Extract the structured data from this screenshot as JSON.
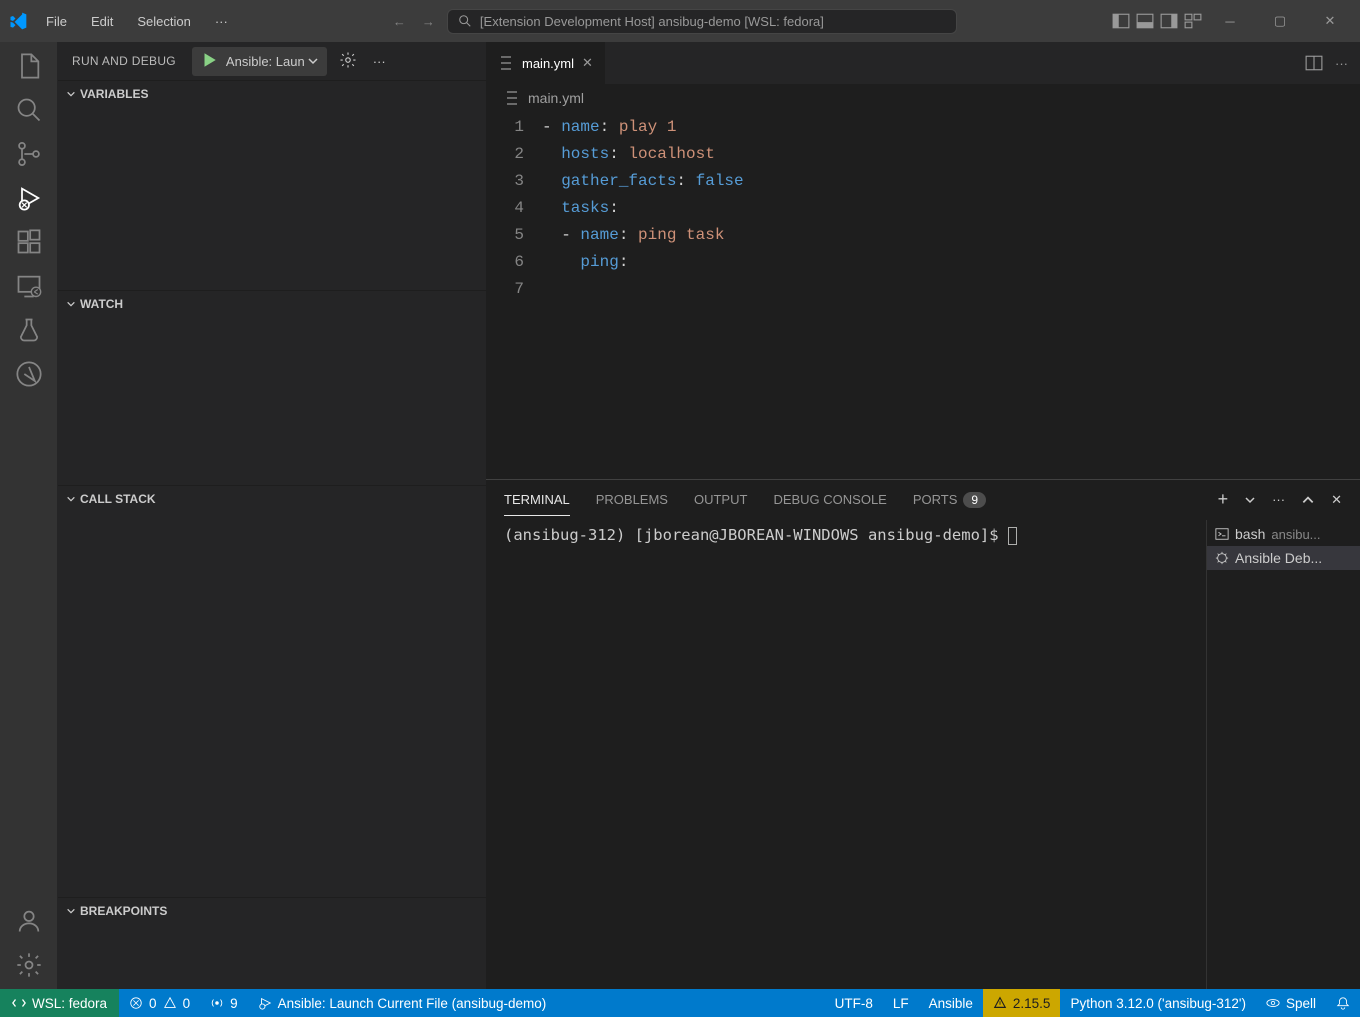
{
  "menu": {
    "file": "File",
    "edit": "Edit",
    "selection": "Selection",
    "more": "···"
  },
  "titlebar_search": "[Extension Development Host] ansibug-demo [WSL: fedora]",
  "sidebar": {
    "title": "RUN AND DEBUG",
    "config_name": "Ansible: Laun",
    "sections": {
      "variables": "VARIABLES",
      "watch": "WATCH",
      "callstack": "CALL STACK",
      "breakpoints": "BREAKPOINTS"
    }
  },
  "editor": {
    "tab_name": "main.yml",
    "breadcrumb": "main.yml",
    "line_numbers": [
      "1",
      "2",
      "3",
      "4",
      "5",
      "6",
      "7"
    ],
    "code": {
      "l1_key": "name",
      "l1_val": "play 1",
      "l2_key": "hosts",
      "l2_val": "localhost",
      "l3_key": "gather_facts",
      "l3_val": "false",
      "l4_key": "tasks",
      "l5_key": "name",
      "l5_val": "ping task",
      "l6_key": "ping"
    }
  },
  "panel": {
    "tabs": {
      "terminal": "TERMINAL",
      "problems": "PROBLEMS",
      "output": "OUTPUT",
      "debug": "DEBUG CONSOLE",
      "ports": "PORTS"
    },
    "ports_badge": "9",
    "terminal_prompt": "(ansibug-312) [jborean@JBOREAN-WINDOWS ansibug-demo]$ ",
    "terminals": [
      {
        "name": "bash",
        "sub": "ansibu..."
      },
      {
        "name": "Ansible Deb..."
      }
    ]
  },
  "statusbar": {
    "remote": "WSL: fedora",
    "errors": "0",
    "warnings": "0",
    "ports": "9",
    "debug_target": "Ansible: Launch Current File (ansibug-demo)",
    "encoding": "UTF-8",
    "eol": "LF",
    "language": "Ansible",
    "ansible_version": "2.15.5",
    "python": "Python 3.12.0 ('ansibug-312')",
    "spell": "Spell"
  }
}
